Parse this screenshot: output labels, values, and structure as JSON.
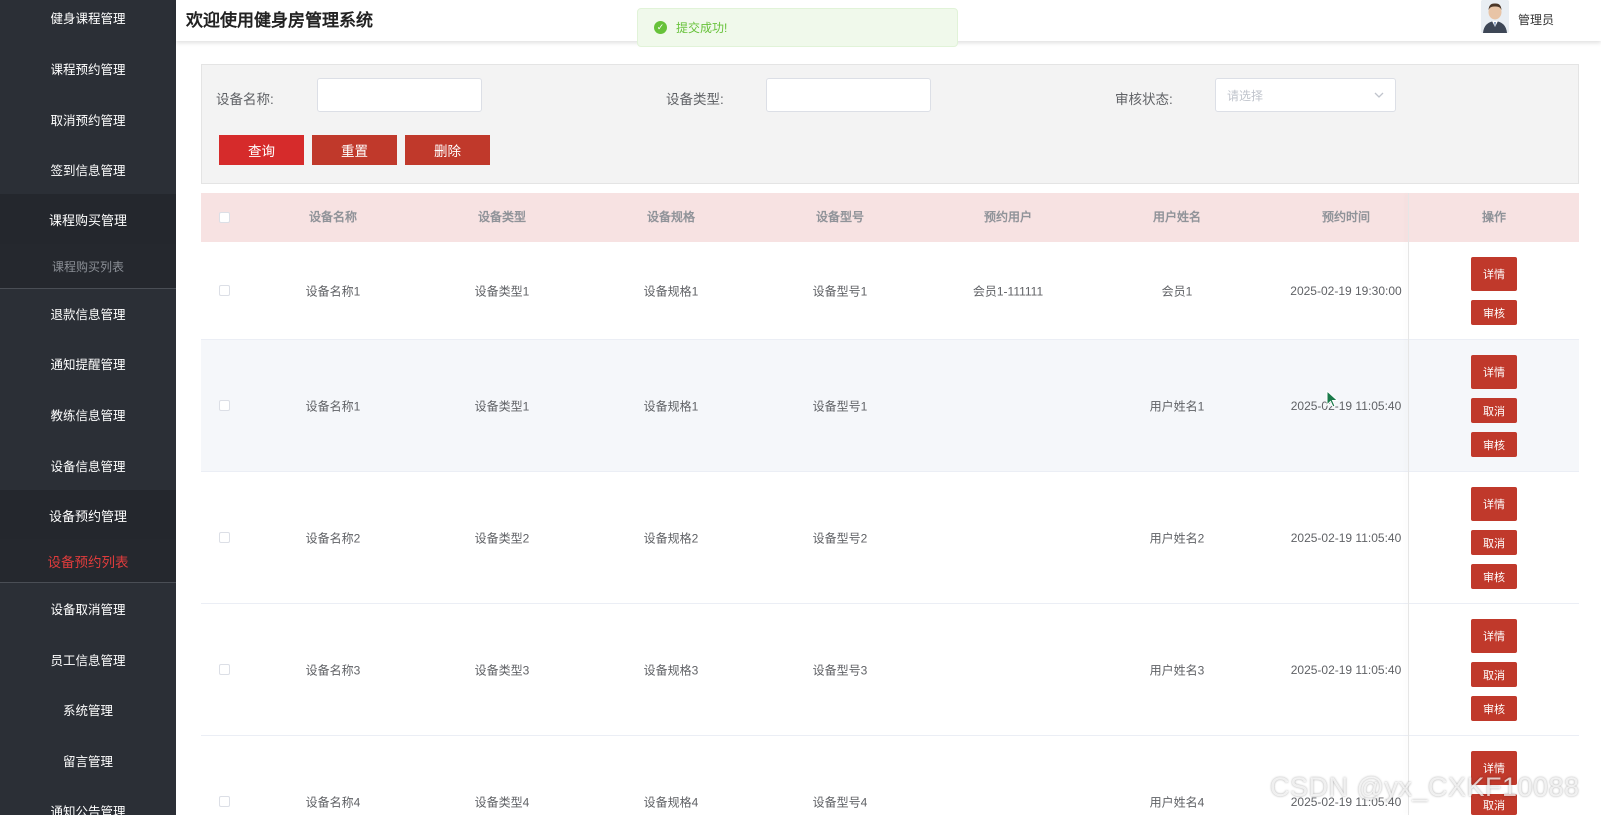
{
  "sidebar": {
    "items": [
      {
        "label": "健身课程管理"
      },
      {
        "label": "课程预约管理"
      },
      {
        "label": "取消预约管理"
      },
      {
        "label": "签到信息管理"
      },
      {
        "label": "课程购买管理"
      },
      {
        "label": "课程购买列表"
      },
      {
        "label": "退款信息管理"
      },
      {
        "label": "通知提醒管理"
      },
      {
        "label": "教练信息管理"
      },
      {
        "label": "设备信息管理"
      },
      {
        "label": "设备预约管理"
      },
      {
        "label": "设备预约列表"
      },
      {
        "label": "设备取消管理"
      },
      {
        "label": "员工信息管理"
      },
      {
        "label": "系统管理"
      },
      {
        "label": "留言管理"
      },
      {
        "label": "通知公告管理"
      }
    ]
  },
  "header": {
    "title": "欢迎使用健身房管理系统",
    "user": "管理员"
  },
  "toast": {
    "message": "提交成功!"
  },
  "search": {
    "name_label": "设备名称:",
    "type_label": "设备类型:",
    "status_label": "审核状态:",
    "status_placeholder": "请选择",
    "query_label": "查询",
    "reset_label": "重置",
    "delete_label": "删除"
  },
  "table": {
    "headers": [
      "设备名称",
      "设备类型",
      "设备规格",
      "设备型号",
      "预约用户",
      "用户姓名",
      "预约时间",
      "操作"
    ],
    "rows": [
      {
        "name": "设备名称1",
        "type": "设备类型1",
        "spec": "设备规格1",
        "model": "设备型号1",
        "user": "会员1-111111",
        "realname": "会员1",
        "time": "2025-02-19 19:30:00",
        "actions": [
          "详情",
          "审核"
        ]
      },
      {
        "name": "设备名称1",
        "type": "设备类型1",
        "spec": "设备规格1",
        "model": "设备型号1",
        "user": "",
        "realname": "用户姓名1",
        "time": "2025-02-19 11:05:40",
        "actions": [
          "详情",
          "取消",
          "审核"
        ]
      },
      {
        "name": "设备名称2",
        "type": "设备类型2",
        "spec": "设备规格2",
        "model": "设备型号2",
        "user": "",
        "realname": "用户姓名2",
        "time": "2025-02-19 11:05:40",
        "actions": [
          "详情",
          "取消",
          "审核"
        ]
      },
      {
        "name": "设备名称3",
        "type": "设备类型3",
        "spec": "设备规格3",
        "model": "设备型号3",
        "user": "",
        "realname": "用户姓名3",
        "time": "2025-02-19 11:05:40",
        "actions": [
          "详情",
          "取消",
          "审核"
        ]
      },
      {
        "name": "设备名称4",
        "type": "设备类型4",
        "spec": "设备规格4",
        "model": "设备型号4",
        "user": "",
        "realname": "用户姓名4",
        "time": "2025-02-19 11:05:40",
        "actions": [
          "详情",
          "取消"
        ]
      }
    ]
  },
  "watermark": "CSDN @yx_CXKF10088",
  "colors": {
    "sidebar_bg": "#2b2f36",
    "accent_red": "#c0392b",
    "active_menu": "#e03c3c",
    "table_header_bg": "#f7e2e2",
    "toast_green": "#67c23a"
  }
}
